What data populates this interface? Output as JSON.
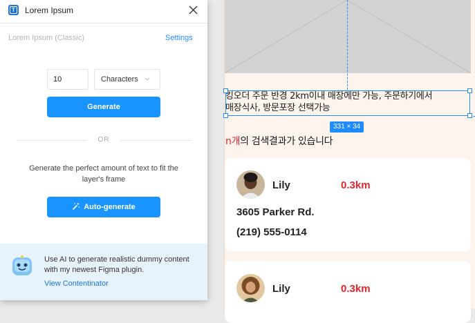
{
  "plugin": {
    "title": "Lorem Ipsum",
    "preset_label": "Lorem Ipsum (Classic)",
    "settings_label": "Settings",
    "count_value": "10",
    "unit_selected": "Characters",
    "generate_label": "Generate",
    "or_label": "OR",
    "auto_description": "Generate the perfect amount of text to fit the layer's frame",
    "auto_generate_label": "Auto-generate",
    "promo_text": "Use AI to generate realistic dummy content with my newest Figma plugin.",
    "promo_link": "View Contentinator"
  },
  "canvas": {
    "text_line_1": "킹오더 주문 반경 2km이내 매장에만 가능, 주문하기에서",
    "text_line_2": "매장식사, 방문포장 선택가능",
    "selection_size": "331 × 34",
    "result_highlight": "n개",
    "result_rest": "의 검색결과가 있습니다",
    "cards": [
      {
        "name": "Lily",
        "distance": "0.3km",
        "address": "3605 Parker Rd.",
        "phone": "(219) 555-0114"
      },
      {
        "name": "Lily",
        "distance": "0.3km"
      }
    ]
  },
  "colors": {
    "accent_blue": "#1994ff",
    "selection_blue": "#1e8cff",
    "highlight_red": "#e8242b",
    "frame_bg": "#fdf4ee",
    "promo_bg": "#e6f3fd"
  }
}
